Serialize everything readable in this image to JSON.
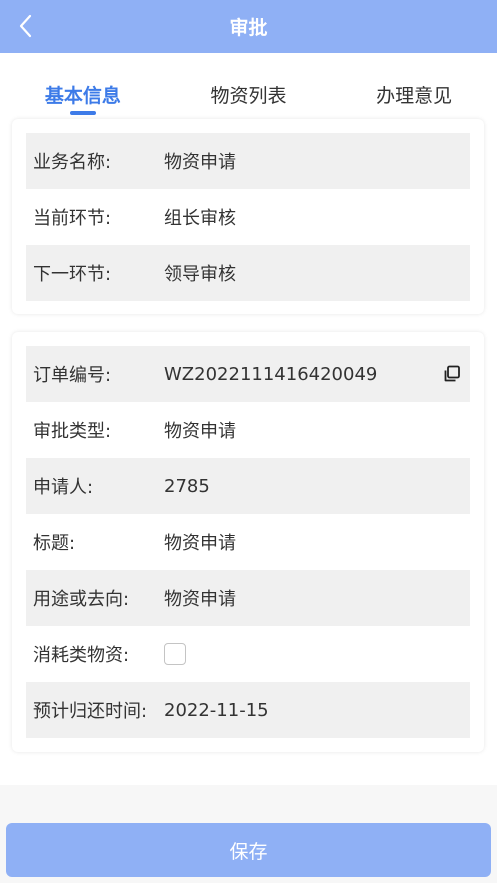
{
  "header": {
    "title": "审批",
    "back_icon": "chevron-left-icon"
  },
  "tabs": [
    {
      "label": "基本信息",
      "active": true
    },
    {
      "label": "物资列表",
      "active": false
    },
    {
      "label": "办理意见",
      "active": false
    }
  ],
  "flow_card": {
    "business_name": {
      "label": "业务名称:",
      "value": "物资申请"
    },
    "current_step": {
      "label": "当前环节:",
      "value": "组长审核"
    },
    "next_step": {
      "label": "下一环节:",
      "value": "领导审核"
    }
  },
  "detail_card": {
    "order_no": {
      "label": "订单编号:",
      "value": "WZ2022111416420049",
      "icon": "copy-icon"
    },
    "approval_type": {
      "label": "审批类型:",
      "value": "物资申请"
    },
    "applicant": {
      "label": "申请人:",
      "value": "2785"
    },
    "title": {
      "label": "标题:",
      "value": "物资申请"
    },
    "purpose": {
      "label": "用途或去向:",
      "value": "物资申请"
    },
    "consumable": {
      "label": "消耗类物资:",
      "checked": false
    },
    "return_date": {
      "label": "预计归还时间:",
      "value": "2022-11-15"
    }
  },
  "footer": {
    "save_label": "保存"
  },
  "colors": {
    "header_bg": "#8fb0f5",
    "accent": "#3d7be8",
    "row_shade": "#f0f0f0"
  }
}
